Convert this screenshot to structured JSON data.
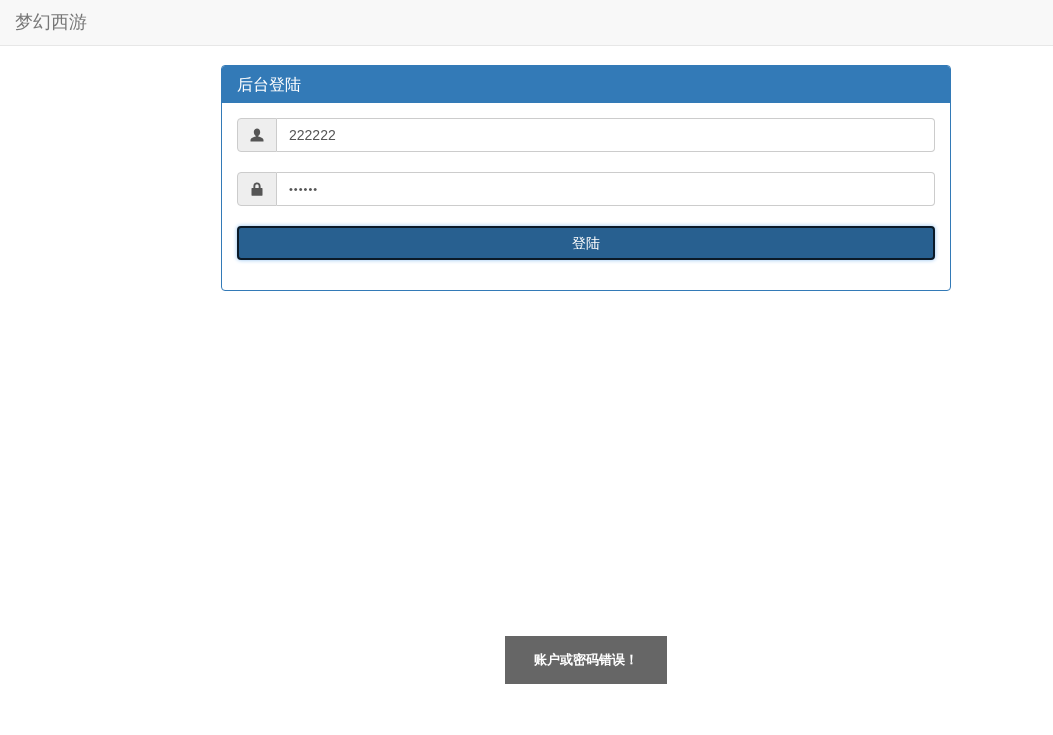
{
  "navbar": {
    "brand": "梦幻西游"
  },
  "login_panel": {
    "title": "后台登陆",
    "fields": [
      {
        "kind": "user",
        "value": "222222"
      },
      {
        "kind": "password",
        "value": "••••••"
      }
    ],
    "submit": {
      "label": "登陆",
      "focused": true
    }
  },
  "toast": {
    "message": "账户或密码错误！"
  }
}
